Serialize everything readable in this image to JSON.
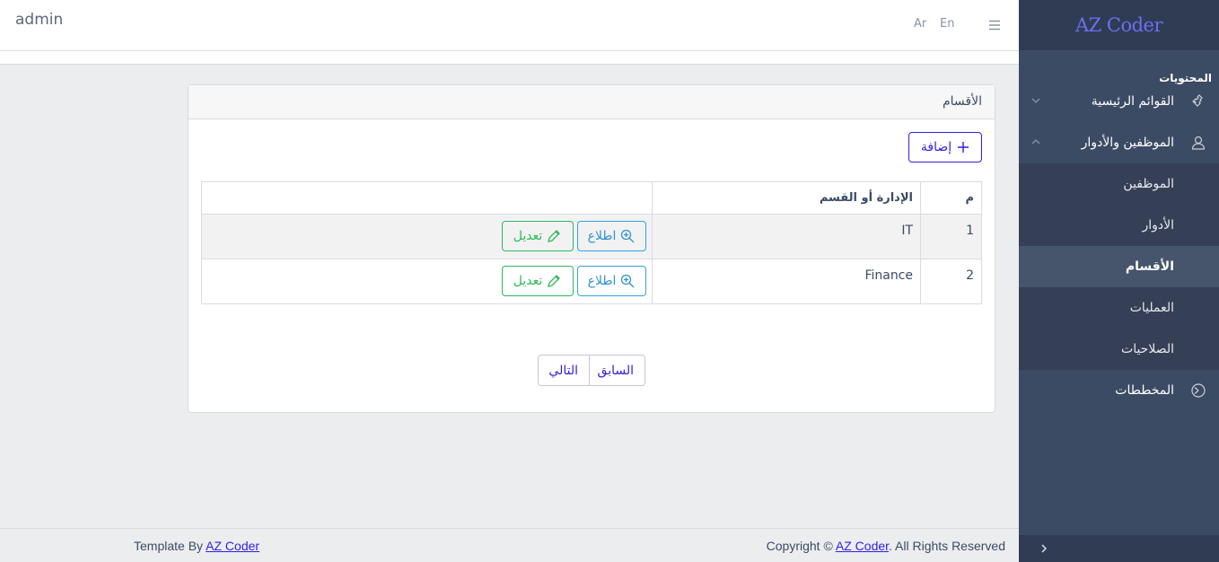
{
  "header": {
    "user": "admin",
    "lang_ar": "Ar",
    "lang_en": "En"
  },
  "sidebar": {
    "brand": "AZ Coder",
    "section_title": "المحتويات",
    "items": [
      {
        "label": "القوائم الرئيسية",
        "icon": "puzzle-icon"
      },
      {
        "label": "الموظفين والأدوار",
        "icon": "user-icon"
      },
      {
        "label": "المخططات",
        "icon": "chart-pie-icon"
      }
    ],
    "subitems": [
      {
        "label": "الموظفين"
      },
      {
        "label": "الأدوار"
      },
      {
        "label": "الأقسام",
        "active": true
      },
      {
        "label": "العمليات"
      },
      {
        "label": "الصلاحيات"
      }
    ]
  },
  "card": {
    "title": "الأقسام",
    "add_label": "إضافة"
  },
  "table": {
    "headers": {
      "num": "م",
      "name": "الإدارة أو القسم",
      "actions": ""
    },
    "rows": [
      {
        "num": "1",
        "name": "IT",
        "view": "اطلاع",
        "edit": "تعديل"
      },
      {
        "num": "2",
        "name": "Finance",
        "view": "اطلاع",
        "edit": "تعديل"
      }
    ]
  },
  "pager": {
    "prev": "السابق",
    "next": "التالي"
  },
  "footer": {
    "left_prefix": "Template By ",
    "left_link": "AZ Coder",
    "right_prefix": "Copyright © ",
    "right_link": "AZ Coder",
    "right_suffix": ". All Rights Reserved"
  },
  "colors": {
    "sidebar_bg": "#3c4b64",
    "brand_bg": "#303c54",
    "primary": "#321fdb",
    "info": "#39a0e4",
    "success": "#2eb85c"
  }
}
